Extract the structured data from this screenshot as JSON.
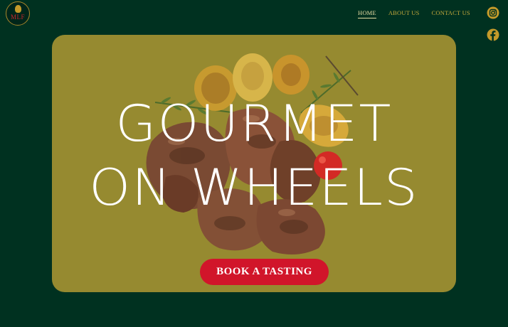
{
  "brand": {
    "logo_text": "MLF"
  },
  "nav": {
    "items": [
      {
        "label": "HOME"
      },
      {
        "label": "ABOUT US"
      },
      {
        "label": "CONTACT US"
      }
    ]
  },
  "social": [
    "instagram-icon",
    "facebook-icon"
  ],
  "hero": {
    "title_line1": "GOURMET",
    "title_line2": "ON WHEELS",
    "cta_label": "BOOK A TASTING"
  },
  "colors": {
    "page_bg": "#003120",
    "hero_bg": "#968a30",
    "accent_gold": "#c49a2a",
    "cta_red": "#d1152a"
  }
}
